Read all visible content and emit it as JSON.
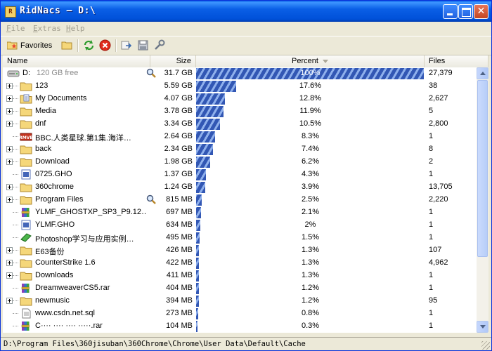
{
  "window": {
    "title": "RidNacs – D:\\",
    "app_icon": "ridnacs-app-icon",
    "controls": [
      "minimize-button",
      "maximize-button",
      "close-button"
    ]
  },
  "menu": {
    "items": [
      "File",
      "Extras",
      "Help"
    ]
  },
  "toolbar": {
    "favorites_label": "Favorites",
    "icons": [
      "open-folder-icon",
      "refresh-icon",
      "stop-icon",
      "export-icon",
      "save-icon",
      "settings-icon"
    ]
  },
  "columns": {
    "name": "Name",
    "size": "Size",
    "percent": "Percent",
    "files": "Files"
  },
  "rows": [
    {
      "name": "D:",
      "extra": "120 GB free",
      "size": "31.7 GB",
      "percent": "100%",
      "pct_value": 100,
      "files": "27,379",
      "type": "drive",
      "magnifier": true
    },
    {
      "name": "123",
      "size": "5.59 GB",
      "percent": "17.6%",
      "pct_value": 17.6,
      "files": "38",
      "type": "folder"
    },
    {
      "name": "My Documents",
      "size": "4.07 GB",
      "percent": "12.8%",
      "pct_value": 12.8,
      "files": "2,627",
      "type": "docs"
    },
    {
      "name": "Media",
      "size": "3.78 GB",
      "percent": "11.9%",
      "pct_value": 11.9,
      "files": "5",
      "type": "folder"
    },
    {
      "name": "dnf",
      "size": "3.34 GB",
      "percent": "10.5%",
      "pct_value": 10.5,
      "files": "2,800",
      "type": "folder"
    },
    {
      "name": "BBC.人类星球.第1集.海洋…",
      "size": "2.64 GB",
      "percent": "8.3%",
      "pct_value": 8.3,
      "files": "1",
      "type": "video"
    },
    {
      "name": "back",
      "size": "2.34 GB",
      "percent": "7.4%",
      "pct_value": 7.4,
      "files": "8",
      "type": "folder"
    },
    {
      "name": "Download",
      "size": "1.98 GB",
      "percent": "6.2%",
      "pct_value": 6.2,
      "files": "2",
      "type": "folder"
    },
    {
      "name": "0725.GHO",
      "size": "1.37 GB",
      "percent": "4.3%",
      "pct_value": 4.3,
      "files": "1",
      "type": "file"
    },
    {
      "name": "360chrome",
      "size": "1.24 GB",
      "percent": "3.9%",
      "pct_value": 3.9,
      "files": "13,705",
      "type": "folder"
    },
    {
      "name": "Program Files",
      "size": "815 MB",
      "percent": "2.5%",
      "pct_value": 2.5,
      "files": "2,220",
      "type": "folder",
      "magnifier": true
    },
    {
      "name": "YLMF_GHOSTXP_SP3_P9.12…",
      "size": "697 MB",
      "percent": "2.1%",
      "pct_value": 2.1,
      "files": "1",
      "type": "rar"
    },
    {
      "name": "YLMF.GHO",
      "size": "634 MB",
      "percent": "2%",
      "pct_value": 2.0,
      "files": "1",
      "type": "file"
    },
    {
      "name": "Photoshop学习与应用实例…",
      "size": "495 MB",
      "percent": "1.5%",
      "pct_value": 1.5,
      "files": "1",
      "type": "book"
    },
    {
      "name": "E63备份",
      "size": "426 MB",
      "percent": "1.3%",
      "pct_value": 1.3,
      "files": "107",
      "type": "folder"
    },
    {
      "name": "CounterStrike 1.6",
      "size": "422 MB",
      "percent": "1.3%",
      "pct_value": 1.3,
      "files": "4,962",
      "type": "folder"
    },
    {
      "name": "Downloads",
      "size": "411 MB",
      "percent": "1.3%",
      "pct_value": 1.3,
      "files": "1",
      "type": "folder"
    },
    {
      "name": "DreamweaverCS5.rar",
      "size": "404 MB",
      "percent": "1.2%",
      "pct_value": 1.2,
      "files": "1",
      "type": "rar"
    },
    {
      "name": "newmusic",
      "size": "394 MB",
      "percent": "1.2%",
      "pct_value": 1.2,
      "files": "95",
      "type": "folder"
    },
    {
      "name": "www.csdn.net.sql",
      "size": "273 MB",
      "percent": "0.8%",
      "pct_value": 0.8,
      "files": "1",
      "type": "text"
    },
    {
      "name": "C···· ···· ···· ·····.rar",
      "size": "104 MB",
      "percent": "0.3%",
      "pct_value": 0.3,
      "files": "1",
      "type": "rar"
    }
  ],
  "status": {
    "path": "D:\\Program Files\\360jisuban\\360Chrome\\Chrome\\User Data\\Default\\Cache"
  },
  "colors": {
    "bar_dark": "#3257b4",
    "bar_light": "#8fb0ec",
    "title_blue": "#0a5fe6"
  }
}
